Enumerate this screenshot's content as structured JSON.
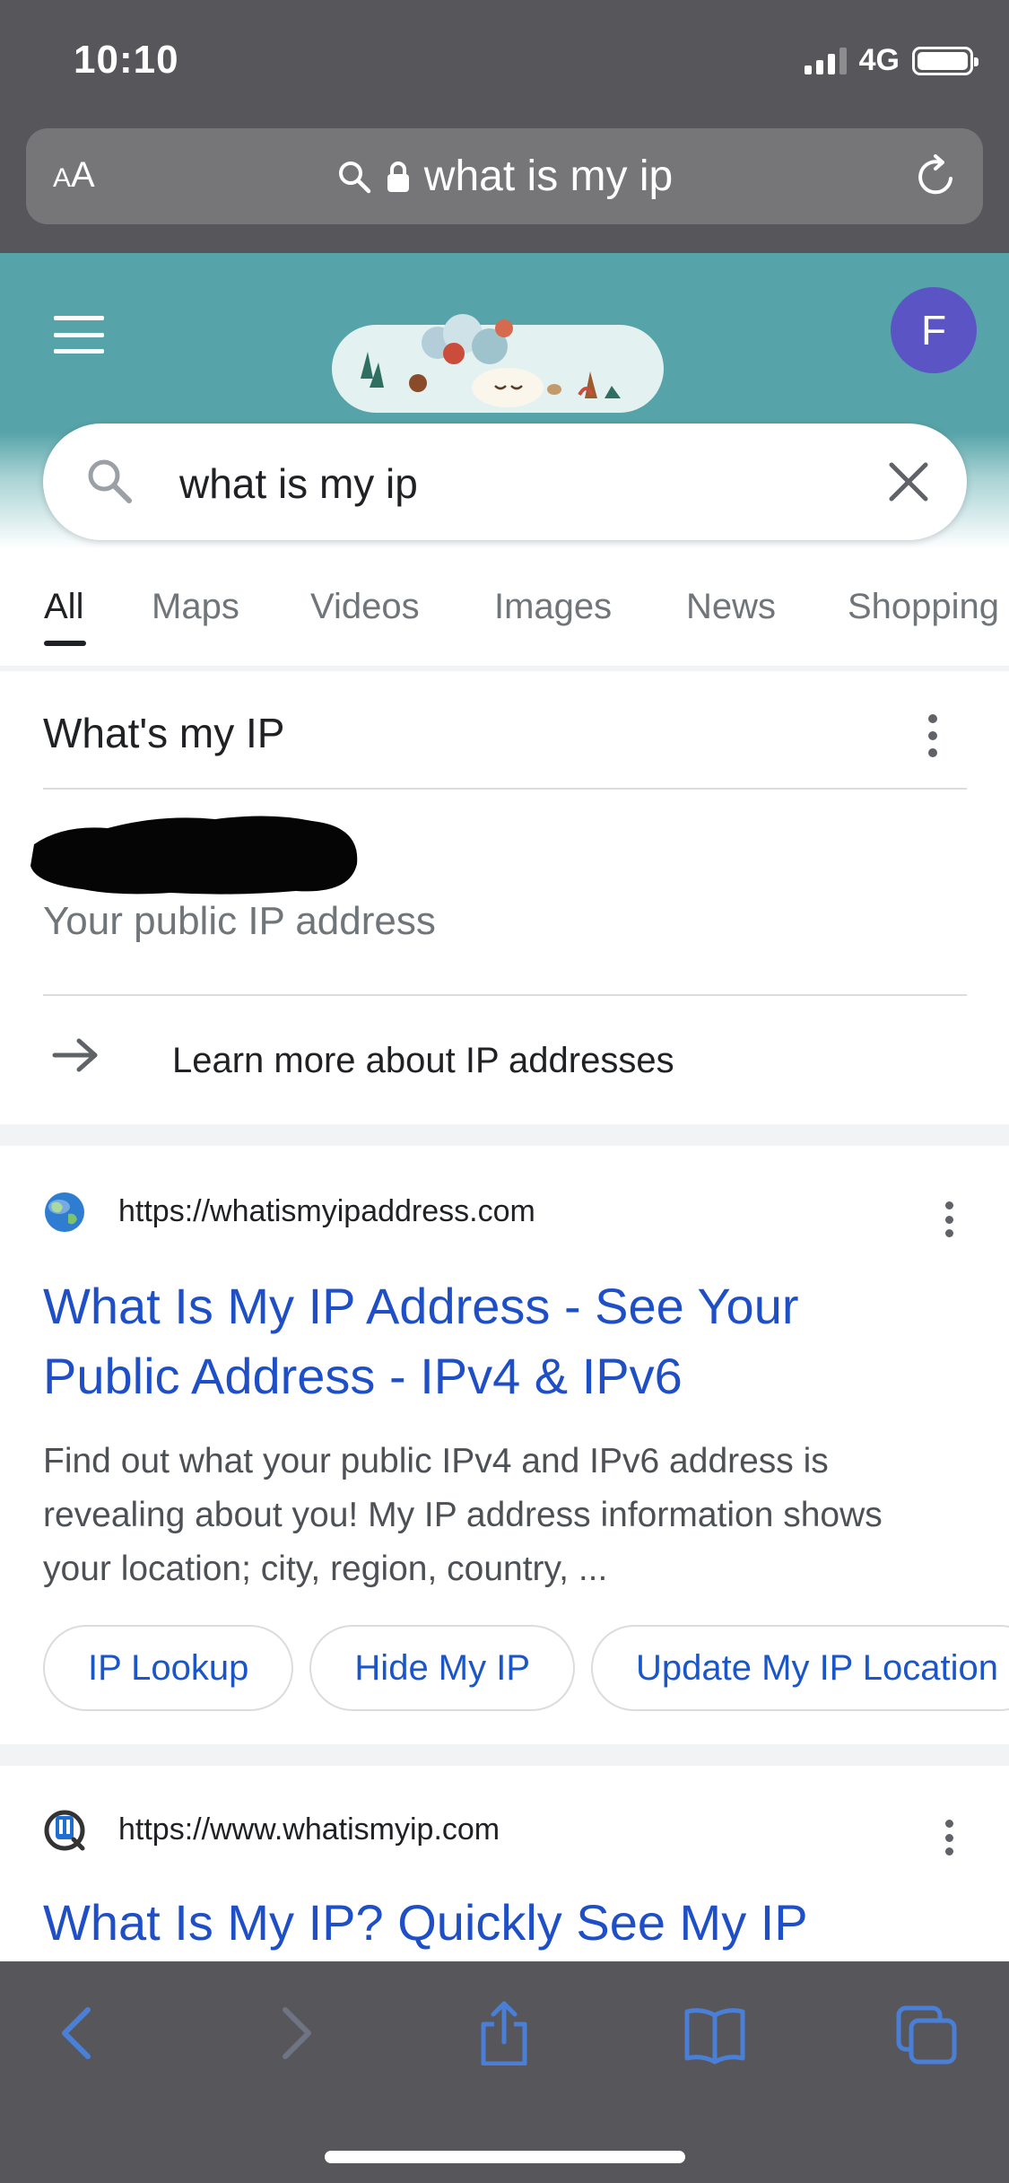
{
  "status_bar": {
    "time": "10:10",
    "network": "4G"
  },
  "safari": {
    "text_size_label_small": "A",
    "text_size_label_large": "A",
    "address": "what is my ip"
  },
  "google": {
    "avatar_letter": "F",
    "search_query": "what is my ip",
    "tabs": [
      "All",
      "Maps",
      "Videos",
      "Images",
      "News",
      "Shopping"
    ],
    "active_tab": "All"
  },
  "ip_card": {
    "title": "What's my IP",
    "subtitle": "Your public IP address",
    "learn_more": "Learn more about IP addresses"
  },
  "results": [
    {
      "url": "https://whatismyipaddress.com",
      "title_line1": "What Is My IP Address - See Your",
      "title_line2": "Public Address - IPv4 & IPv6",
      "snippet_line1": "Find out what your public IPv4 and IPv6 address is",
      "snippet_line2": "revealing about you! My IP address information shows",
      "snippet_line3": "your location; city, region, country, ...",
      "chips": [
        "IP Lookup",
        "Hide My IP",
        "Update My IP Location"
      ]
    },
    {
      "url": "https://www.whatismyip.com",
      "title_line1": "What Is My IP? Quickly See My IP"
    }
  ],
  "colors": {
    "chrome_gray": "#57575b",
    "doodle_teal": "#56a4a9",
    "link_blue": "#1f4fc7",
    "avatar_purple": "#5a54c4",
    "toolbar_blue": "#4a7fd8"
  }
}
